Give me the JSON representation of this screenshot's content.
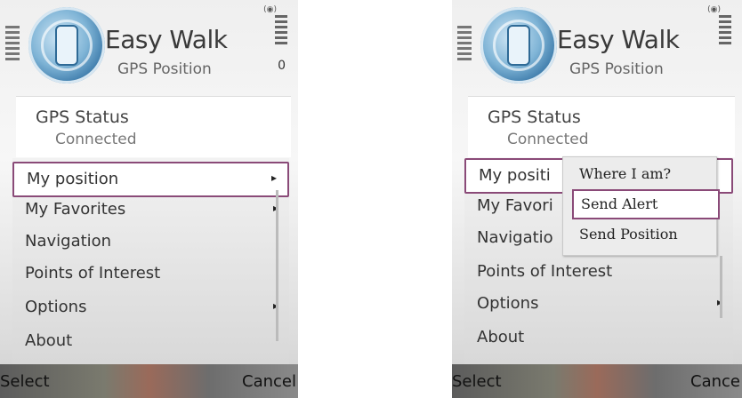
{
  "screens": [
    {
      "app_title": "Easy Walk",
      "app_subtitle": "GPS Position",
      "battery_value": "0",
      "gps_status_label": "GPS Status",
      "gps_status_value": "Connected",
      "menu": [
        {
          "label": "My position",
          "has_submenu": true,
          "selected": true
        },
        {
          "label": "My Favorites",
          "has_submenu": true,
          "selected": false
        },
        {
          "label": "Navigation",
          "has_submenu": false,
          "selected": false
        },
        {
          "label": "Points of Interest",
          "has_submenu": false,
          "selected": false
        },
        {
          "label": "Options",
          "has_submenu": true,
          "selected": false
        },
        {
          "label": "About",
          "has_submenu": false,
          "selected": false
        }
      ],
      "softkey_left": "Select",
      "softkey_right": "Cancel"
    },
    {
      "app_title": "Easy Walk",
      "app_subtitle": "GPS Position",
      "gps_status_label": "GPS Status",
      "gps_status_value": "Connected",
      "menu": [
        {
          "label": "My positi",
          "has_submenu": true,
          "selected": true
        },
        {
          "label": "My Favori",
          "has_submenu": true,
          "selected": false
        },
        {
          "label": "Navigatio",
          "has_submenu": false,
          "selected": false
        },
        {
          "label": "Points of Interest",
          "has_submenu": false,
          "selected": false
        },
        {
          "label": "Options",
          "has_submenu": true,
          "selected": false
        },
        {
          "label": "About",
          "has_submenu": false,
          "selected": false
        }
      ],
      "submenu": [
        {
          "label": "Where I am?",
          "selected": false
        },
        {
          "label": "Send Alert",
          "selected": true
        },
        {
          "label": "Send Position",
          "selected": false
        }
      ],
      "softkey_left": "Select",
      "softkey_right": "Cance"
    }
  ],
  "icons": {
    "submenu_arrow": "▸",
    "app_logo": "phone-signal-icon"
  },
  "colors": {
    "selection_border": "#8a4a78",
    "logo_blue": "#3a78a8"
  }
}
